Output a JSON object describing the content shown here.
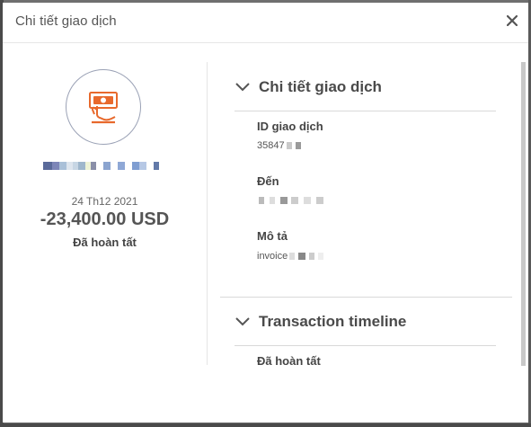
{
  "modal": {
    "title": "Chi tiết giao dịch",
    "close_icon": "close-icon"
  },
  "summary": {
    "icon": "payment-hand-cash-icon",
    "date": "24 Th12 2021",
    "amount": "-23,400.00 USD",
    "status": "Đã hoàn tất"
  },
  "details_section": {
    "title": "Chi tiết giao dịch",
    "fields": [
      {
        "label": "ID giao dịch",
        "value": "35847"
      },
      {
        "label": "Đến",
        "value": ""
      },
      {
        "label": "Mô tả",
        "value": "invoice"
      }
    ]
  },
  "timeline_section": {
    "title": "Transaction timeline",
    "first_entry": "Đã hoàn tất"
  },
  "colors": {
    "accent_icon": "#e8692c",
    "circle_border": "#9aa1b5",
    "text": "#444444"
  }
}
